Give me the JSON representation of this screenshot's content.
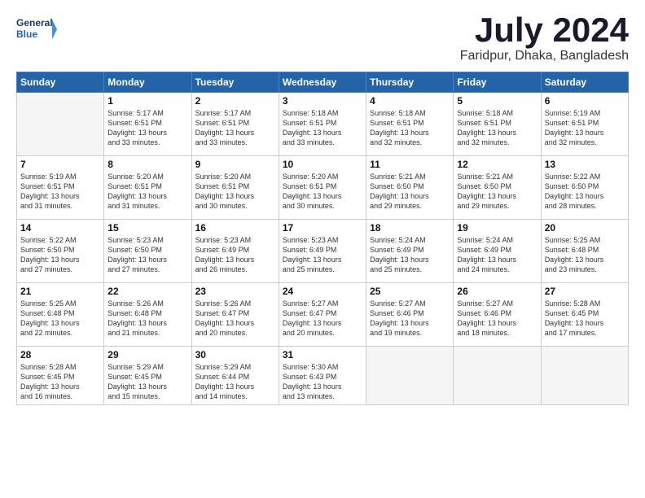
{
  "logo": {
    "line1": "General",
    "line2": "Blue"
  },
  "title": "July 2024",
  "location": "Faridpur, Dhaka, Bangladesh",
  "days_of_week": [
    "Sunday",
    "Monday",
    "Tuesday",
    "Wednesday",
    "Thursday",
    "Friday",
    "Saturday"
  ],
  "weeks": [
    [
      {
        "day": "",
        "info": ""
      },
      {
        "day": "1",
        "info": "Sunrise: 5:17 AM\nSunset: 6:51 PM\nDaylight: 13 hours\nand 33 minutes."
      },
      {
        "day": "2",
        "info": "Sunrise: 5:17 AM\nSunset: 6:51 PM\nDaylight: 13 hours\nand 33 minutes."
      },
      {
        "day": "3",
        "info": "Sunrise: 5:18 AM\nSunset: 6:51 PM\nDaylight: 13 hours\nand 33 minutes."
      },
      {
        "day": "4",
        "info": "Sunrise: 5:18 AM\nSunset: 6:51 PM\nDaylight: 13 hours\nand 32 minutes."
      },
      {
        "day": "5",
        "info": "Sunrise: 5:18 AM\nSunset: 6:51 PM\nDaylight: 13 hours\nand 32 minutes."
      },
      {
        "day": "6",
        "info": "Sunrise: 5:19 AM\nSunset: 6:51 PM\nDaylight: 13 hours\nand 32 minutes."
      }
    ],
    [
      {
        "day": "7",
        "info": "Sunrise: 5:19 AM\nSunset: 6:51 PM\nDaylight: 13 hours\nand 31 minutes."
      },
      {
        "day": "8",
        "info": "Sunrise: 5:20 AM\nSunset: 6:51 PM\nDaylight: 13 hours\nand 31 minutes."
      },
      {
        "day": "9",
        "info": "Sunrise: 5:20 AM\nSunset: 6:51 PM\nDaylight: 13 hours\nand 30 minutes."
      },
      {
        "day": "10",
        "info": "Sunrise: 5:20 AM\nSunset: 6:51 PM\nDaylight: 13 hours\nand 30 minutes."
      },
      {
        "day": "11",
        "info": "Sunrise: 5:21 AM\nSunset: 6:50 PM\nDaylight: 13 hours\nand 29 minutes."
      },
      {
        "day": "12",
        "info": "Sunrise: 5:21 AM\nSunset: 6:50 PM\nDaylight: 13 hours\nand 29 minutes."
      },
      {
        "day": "13",
        "info": "Sunrise: 5:22 AM\nSunset: 6:50 PM\nDaylight: 13 hours\nand 28 minutes."
      }
    ],
    [
      {
        "day": "14",
        "info": "Sunrise: 5:22 AM\nSunset: 6:50 PM\nDaylight: 13 hours\nand 27 minutes."
      },
      {
        "day": "15",
        "info": "Sunrise: 5:23 AM\nSunset: 6:50 PM\nDaylight: 13 hours\nand 27 minutes."
      },
      {
        "day": "16",
        "info": "Sunrise: 5:23 AM\nSunset: 6:49 PM\nDaylight: 13 hours\nand 26 minutes."
      },
      {
        "day": "17",
        "info": "Sunrise: 5:23 AM\nSunset: 6:49 PM\nDaylight: 13 hours\nand 25 minutes."
      },
      {
        "day": "18",
        "info": "Sunrise: 5:24 AM\nSunset: 6:49 PM\nDaylight: 13 hours\nand 25 minutes."
      },
      {
        "day": "19",
        "info": "Sunrise: 5:24 AM\nSunset: 6:49 PM\nDaylight: 13 hours\nand 24 minutes."
      },
      {
        "day": "20",
        "info": "Sunrise: 5:25 AM\nSunset: 6:48 PM\nDaylight: 13 hours\nand 23 minutes."
      }
    ],
    [
      {
        "day": "21",
        "info": "Sunrise: 5:25 AM\nSunset: 6:48 PM\nDaylight: 13 hours\nand 22 minutes."
      },
      {
        "day": "22",
        "info": "Sunrise: 5:26 AM\nSunset: 6:48 PM\nDaylight: 13 hours\nand 21 minutes."
      },
      {
        "day": "23",
        "info": "Sunrise: 5:26 AM\nSunset: 6:47 PM\nDaylight: 13 hours\nand 20 minutes."
      },
      {
        "day": "24",
        "info": "Sunrise: 5:27 AM\nSunset: 6:47 PM\nDaylight: 13 hours\nand 20 minutes."
      },
      {
        "day": "25",
        "info": "Sunrise: 5:27 AM\nSunset: 6:46 PM\nDaylight: 13 hours\nand 19 minutes."
      },
      {
        "day": "26",
        "info": "Sunrise: 5:27 AM\nSunset: 6:46 PM\nDaylight: 13 hours\nand 18 minutes."
      },
      {
        "day": "27",
        "info": "Sunrise: 5:28 AM\nSunset: 6:45 PM\nDaylight: 13 hours\nand 17 minutes."
      }
    ],
    [
      {
        "day": "28",
        "info": "Sunrise: 5:28 AM\nSunset: 6:45 PM\nDaylight: 13 hours\nand 16 minutes."
      },
      {
        "day": "29",
        "info": "Sunrise: 5:29 AM\nSunset: 6:45 PM\nDaylight: 13 hours\nand 15 minutes."
      },
      {
        "day": "30",
        "info": "Sunrise: 5:29 AM\nSunset: 6:44 PM\nDaylight: 13 hours\nand 14 minutes."
      },
      {
        "day": "31",
        "info": "Sunrise: 5:30 AM\nSunset: 6:43 PM\nDaylight: 13 hours\nand 13 minutes."
      },
      {
        "day": "",
        "info": ""
      },
      {
        "day": "",
        "info": ""
      },
      {
        "day": "",
        "info": ""
      }
    ]
  ]
}
